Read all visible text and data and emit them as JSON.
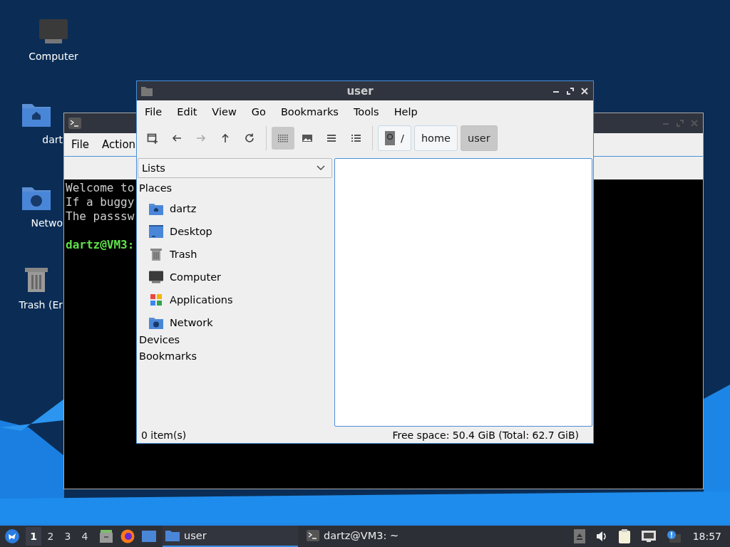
{
  "desktop": {
    "icons": [
      {
        "label": "Computer",
        "kind": "computer"
      },
      {
        "label": "dart",
        "kind": "home"
      },
      {
        "label": "Netwo",
        "kind": "network"
      },
      {
        "label": "Trash (Er",
        "kind": "trash"
      }
    ]
  },
  "terminal": {
    "menu": [
      "File",
      "Action"
    ],
    "lines": [
      {
        "text": "Welcome to",
        "kind": "output"
      },
      {
        "text": "If a buggy",
        "kind": "output"
      },
      {
        "text": "The passsw",
        "kind": "output"
      },
      {
        "text": "dartz@VM3:",
        "kind": "prompt"
      }
    ]
  },
  "file_manager": {
    "title": "user",
    "menu": [
      "File",
      "Edit",
      "View",
      "Go",
      "Bookmarks",
      "Tools",
      "Help"
    ],
    "nav_buttons": [
      {
        "kind": "new-tab",
        "disabled": false
      },
      {
        "kind": "back",
        "disabled": false
      },
      {
        "kind": "forward",
        "disabled": true
      },
      {
        "kind": "up",
        "disabled": false
      },
      {
        "kind": "reload",
        "disabled": false
      }
    ],
    "view_buttons": [
      {
        "kind": "icons",
        "selected": true
      },
      {
        "kind": "thumbnails",
        "selected": false
      },
      {
        "kind": "compact",
        "selected": false
      },
      {
        "kind": "detailed",
        "selected": false
      }
    ],
    "path": [
      {
        "label": "/",
        "kind": "root",
        "selected": false
      },
      {
        "label": "home",
        "kind": "dir",
        "selected": false
      },
      {
        "label": "user",
        "kind": "dir",
        "selected": true
      }
    ],
    "side_pane": {
      "mode": "Lists",
      "sections": [
        {
          "title": "Places",
          "items": [
            {
              "label": "dartz",
              "kind": "home"
            },
            {
              "label": "Desktop",
              "kind": "desktop"
            },
            {
              "label": "Trash",
              "kind": "trash"
            },
            {
              "label": "Computer",
              "kind": "computer"
            },
            {
              "label": "Applications",
              "kind": "apps"
            },
            {
              "label": "Network",
              "kind": "network"
            }
          ]
        },
        {
          "title": "Devices"
        },
        {
          "title": "Bookmarks"
        }
      ]
    },
    "status": {
      "items": "0 item(s)",
      "free_space": "Free space: 50.4 GiB (Total: 62.7 GiB)"
    }
  },
  "taskbar": {
    "workspaces": [
      {
        "label": "1",
        "selected": true
      },
      {
        "label": "2",
        "selected": false
      },
      {
        "label": "3",
        "selected": false
      },
      {
        "label": "4",
        "selected": false
      }
    ],
    "launchers": [
      {
        "kind": "file-manager"
      },
      {
        "kind": "browser"
      },
      {
        "kind": "desktop"
      }
    ],
    "tasks": [
      {
        "label": "user",
        "kind": "folder",
        "selected": true
      },
      {
        "label": "dartz@VM3: ~",
        "kind": "terminal",
        "selected": false
      }
    ],
    "tray": [
      {
        "kind": "eject"
      },
      {
        "kind": "volume"
      },
      {
        "kind": "clipboard"
      },
      {
        "kind": "network"
      },
      {
        "kind": "notification"
      }
    ],
    "clock": "18:57"
  }
}
